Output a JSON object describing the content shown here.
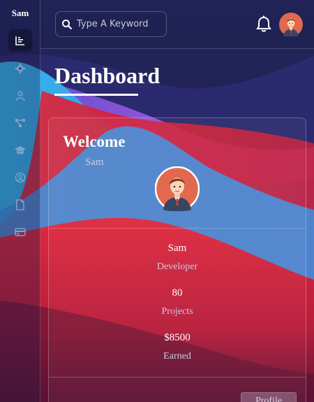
{
  "brand": "Sam",
  "colors": {
    "background_dark": "#1f2150",
    "wave_blue": "#3fa0e8",
    "wave_red": "#d8233a",
    "wave_purple": "#b45ae6",
    "icon": "#7fa3c8",
    "avatar_bg": "#e2694f"
  },
  "sidebar": {
    "items": [
      {
        "icon": "bar-chart-icon",
        "active": true
      },
      {
        "icon": "gear-icon",
        "active": false
      },
      {
        "icon": "user-icon",
        "active": false
      },
      {
        "icon": "network-icon",
        "active": false
      },
      {
        "icon": "graduation-cap-icon",
        "active": false
      },
      {
        "icon": "user-circle-icon",
        "active": false
      },
      {
        "icon": "file-icon",
        "active": false
      },
      {
        "icon": "credit-card-icon",
        "active": false
      }
    ]
  },
  "header": {
    "search_placeholder": "Type A Keyword",
    "notification_icon": "bell-icon",
    "avatar_icon": "avatar-icon"
  },
  "page": {
    "title": "Dashboard"
  },
  "card": {
    "welcome": "Welcome",
    "name": "Sam",
    "profile_name": "Sam",
    "role": "Developer",
    "projects_value": "80",
    "projects_label": "Projects",
    "earned_value": "$8500",
    "earned_label": "Earned",
    "profile_button": "Profile"
  }
}
